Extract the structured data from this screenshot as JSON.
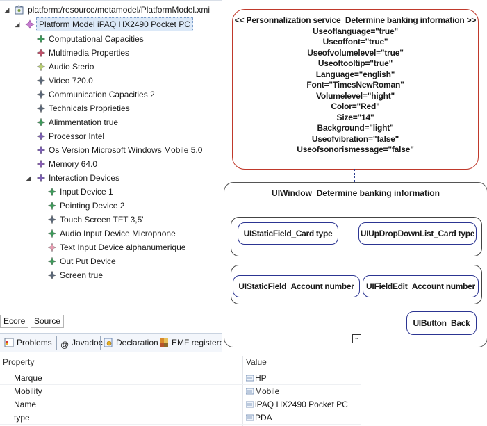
{
  "tree": {
    "root": "platform:/resource/metamodel/PlatformModel.xmi",
    "device": "Platform Model iPAQ HX2490 Pocket PC",
    "children": [
      "Computational Capacities",
      "Multimedia Properties",
      "Audio Sterio",
      "Video 720.0",
      "Communication Capacities 2",
      "Technicals Proprieties",
      "Alimmentation true",
      "Processor Intel",
      "Os Version Microsoft Windows Mobile 5.0",
      "Memory 64.0",
      "Interaction Devices"
    ],
    "interaction_children": [
      "Input Device 1",
      "Pointing Device 2",
      "Touch Screen TFT 3,5'",
      "Audio Input Device Microphone",
      "Text Input Device alphanumerique",
      "Out Put Device",
      "Screen true"
    ]
  },
  "editor_tabs": [
    "Ecore",
    "Source"
  ],
  "view_tabs": [
    "Problems",
    "Javadoc",
    "Declaration",
    "EMF registered"
  ],
  "properties": {
    "col_property": "Property",
    "col_value": "Value",
    "rows": [
      {
        "name": "Marque",
        "value": "HP"
      },
      {
        "name": "Mobility",
        "value": "Mobile"
      },
      {
        "name": "Name",
        "value": "iPAQ HX2490 Pocket PC"
      },
      {
        "name": "type",
        "value": "PDA"
      }
    ]
  },
  "personalization": {
    "title": "<< Personnalization service_Determine banking information >>",
    "lines": [
      "Useoflanguage=\"true\"",
      "Useoffont=\"true\"",
      "Useofvolumelevel=\"true\"",
      "Useoftooltip=\"true\"",
      "Language=\"english\"",
      "Font=\"TimesNewRoman\"",
      "Volumelevel=\"hight\"",
      "Color=\"Red\"",
      "Size=\"14\"",
      "Background=\"light\"",
      "Useofvibration=\"false\"",
      "Useofsonorismessage=\"false\""
    ]
  },
  "window": {
    "title": "UIWindow_Determine banking information",
    "field_card_label": "UIStaticField_Card type",
    "field_card_dropdown": "UIUpDropDownList_Card type",
    "field_account_label": "UIStaticField_Account number",
    "field_account_edit": "UIFieldEdit_Account number",
    "button_back": "UIButton_Back",
    "collapse_glyph": "~"
  },
  "colors": {
    "personalization_border": "#c0392b",
    "field_border": "#2c3592",
    "selection_bg": "#dce9f8"
  }
}
